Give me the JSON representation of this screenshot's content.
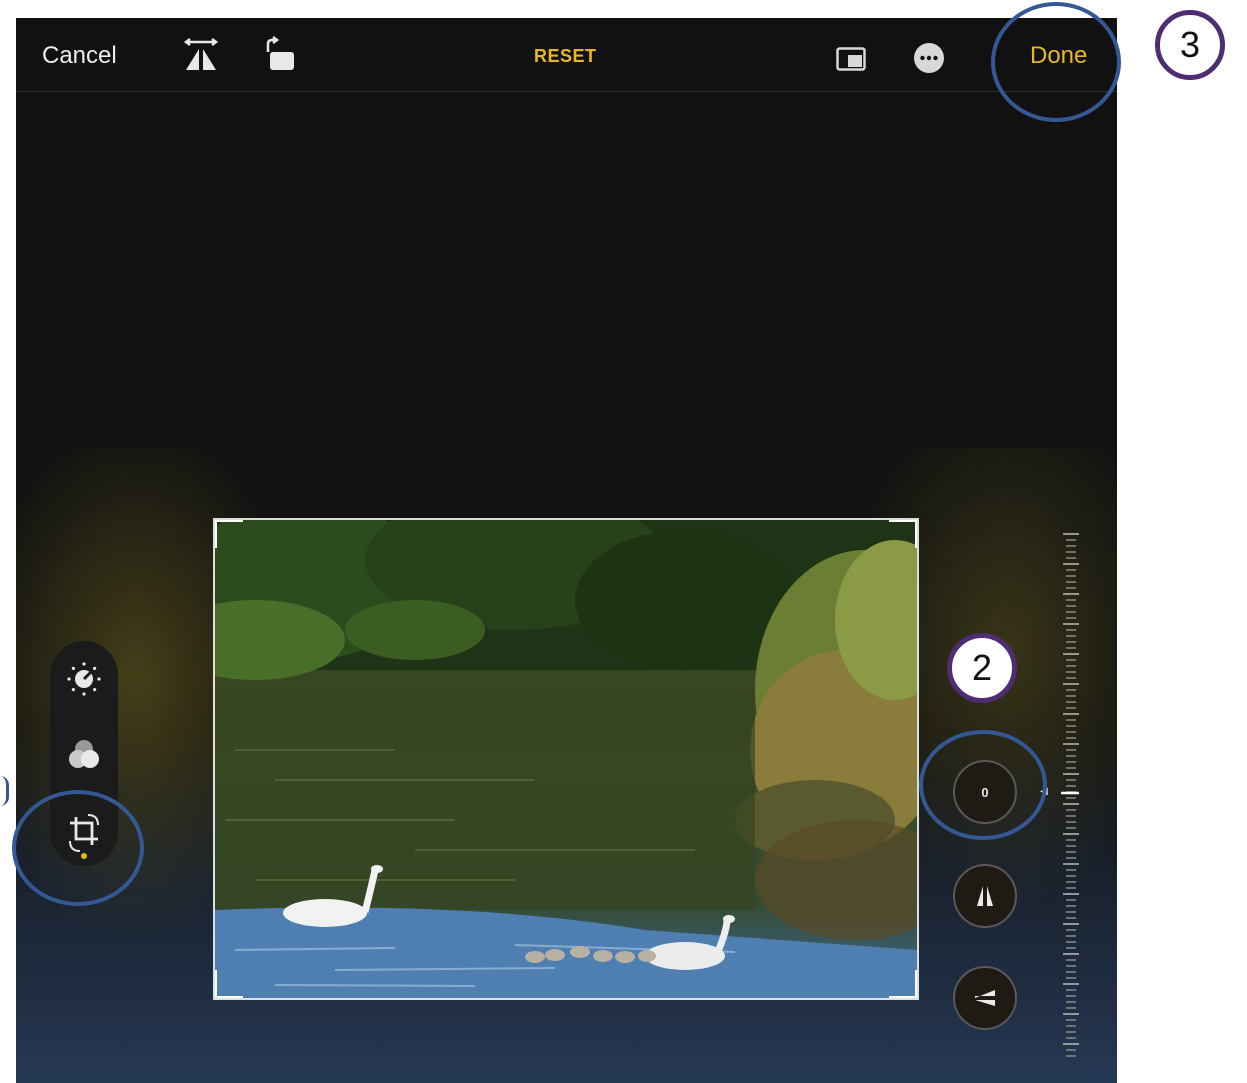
{
  "toolbar": {
    "cancel_label": "Cancel",
    "reset_label": "RESET",
    "done_label": "Done",
    "icons": [
      "flip-horizontal-icon",
      "rotate-icon",
      "aspect-ratio-icon",
      "more-options-icon"
    ]
  },
  "tools": {
    "items": [
      "adjust-icon",
      "filters-icon",
      "crop-rotate-icon"
    ],
    "active": "crop-rotate-icon"
  },
  "straighten": {
    "value": "0",
    "controls": [
      "straighten-dial",
      "vertical-perspective-button",
      "horizontal-perspective-button"
    ]
  },
  "annotations": {
    "step2": "2",
    "step3": "3"
  },
  "colors": {
    "accent": "#e9b81e",
    "annotation_ring": "#345893",
    "annotation_number_border": "#4f2d73"
  }
}
